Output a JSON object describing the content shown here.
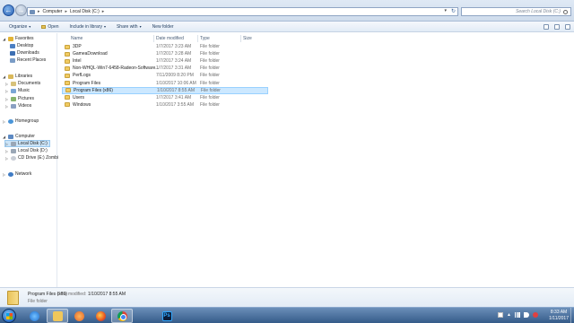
{
  "address_bar": {
    "crumbs": [
      "Computer",
      "Local Disk (C:)"
    ],
    "search_placeholder": "Search Local Disk (C:)"
  },
  "commands": {
    "organize": "Organize",
    "open": "Open",
    "include_in_library": "Include in library",
    "share_with": "Share with",
    "new_folder": "New folder"
  },
  "columns": {
    "name": "Name",
    "date_modified": "Date modified",
    "type": "Type",
    "size": "Size"
  },
  "nav": {
    "favorites": "Favorites",
    "desktop": "Desktop",
    "downloads": "Downloads",
    "recent_places": "Recent Places",
    "libraries": "Libraries",
    "documents": "Documents",
    "music": "Music",
    "pictures": "Pictures",
    "videos": "Videos",
    "homegroup": "Homegroup",
    "computer": "Computer",
    "local_disk_c": "Local Disk (C:)",
    "local_disk_d": "Local Disk (D:)",
    "cd_drive": "CD Drive (E:) Zombi",
    "network": "Network"
  },
  "files": [
    {
      "name": "3DP",
      "date": "1/7/2017 3:23 AM",
      "type": "File folder"
    },
    {
      "name": "GameaDownload",
      "date": "1/7/2017 3:28 AM",
      "type": "File folder"
    },
    {
      "name": "Intel",
      "date": "1/7/2017 3:24 AM",
      "type": "File folder"
    },
    {
      "name": "Non-WHQL-Win7-6458-Radeon-Software...",
      "date": "1/7/2017 3:31 AM",
      "type": "File folder"
    },
    {
      "name": "PerfLogs",
      "date": "7/11/2009 8:20 PM",
      "type": "File folder"
    },
    {
      "name": "Program Files",
      "date": "1/10/2017 10:06 AM",
      "type": "File folder"
    },
    {
      "name": "Program Files (x86)",
      "date": "1/10/2017 8:55 AM",
      "type": "File folder"
    },
    {
      "name": "Users",
      "date": "1/7/2017 3:41 AM",
      "type": "File folder"
    },
    {
      "name": "Windows",
      "date": "1/10/2017 3:55 AM",
      "type": "File folder"
    }
  ],
  "selected_index": 6,
  "details": {
    "name": "Program Files (x86)",
    "modified_label": "Date modified:",
    "modified_value": "1/10/2017 8:55 AM",
    "type": "File folder"
  },
  "clock": {
    "time": "8:33 AM",
    "date": "1/11/2017"
  },
  "icons": {
    "taskbar": [
      "internet-explorer-icon",
      "explorer-icon",
      "media-player-icon",
      "firefox-icon",
      "chrome-icon",
      "photoshop-icon"
    ],
    "photoshop_glyph": "Ps"
  }
}
